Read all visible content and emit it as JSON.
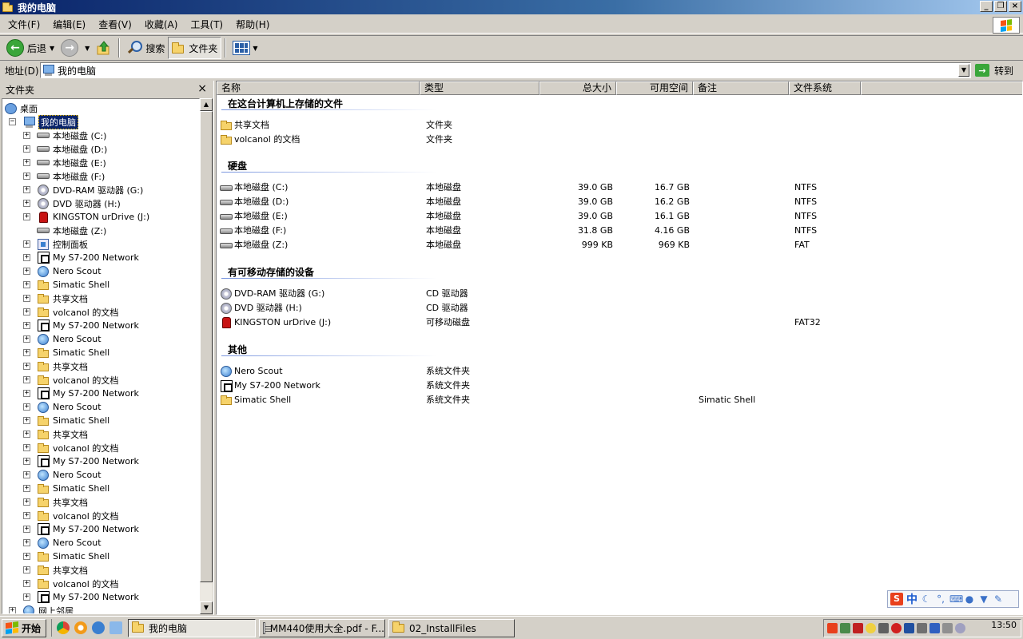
{
  "window": {
    "title": "我的电脑"
  },
  "menu": [
    "文件(F)",
    "编辑(E)",
    "查看(V)",
    "收藏(A)",
    "工具(T)",
    "帮助(H)"
  ],
  "toolbar": {
    "back": "后退",
    "search": "搜索",
    "folders": "文件夹"
  },
  "address": {
    "label": "地址(D)",
    "value": "我的电脑",
    "go": "转到"
  },
  "folders_pane": {
    "title": "文件夹"
  },
  "tree": [
    {
      "label": "桌面",
      "icon": "desktop-icon",
      "level": 0,
      "expander": ""
    },
    {
      "label": "我的电脑",
      "icon": "computer-icon",
      "level": 1,
      "expander": "−",
      "selected": true
    },
    {
      "label": "本地磁盘 (C:)",
      "icon": "drive-icon",
      "level": 2,
      "expander": "+"
    },
    {
      "label": "本地磁盘 (D:)",
      "icon": "drive-icon",
      "level": 2,
      "expander": "+"
    },
    {
      "label": "本地磁盘 (E:)",
      "icon": "drive-icon",
      "level": 2,
      "expander": "+"
    },
    {
      "label": "本地磁盘 (F:)",
      "icon": "drive-icon",
      "level": 2,
      "expander": "+"
    },
    {
      "label": "DVD-RAM 驱动器 (G:)",
      "icon": "cd-icon",
      "level": 2,
      "expander": "+"
    },
    {
      "label": "DVD 驱动器 (H:)",
      "icon": "cd-icon",
      "level": 2,
      "expander": "+"
    },
    {
      "label": "KINGSTON urDrive (J:)",
      "icon": "usb-icon",
      "level": 2,
      "expander": "+"
    },
    {
      "label": "本地磁盘 (Z:)",
      "icon": "drive-icon",
      "level": 2,
      "expander": ""
    },
    {
      "label": "控制面板",
      "icon": "control-panel-icon",
      "level": 2,
      "expander": "+"
    },
    {
      "label": "My S7-200 Network",
      "icon": "network-icon",
      "level": 2,
      "expander": "+"
    },
    {
      "label": "Nero Scout",
      "icon": "globe-icon",
      "level": 2,
      "expander": "+"
    },
    {
      "label": "Simatic Shell",
      "icon": "folder-icon",
      "level": 2,
      "expander": "+"
    },
    {
      "label": "共享文档",
      "icon": "folder-icon",
      "level": 2,
      "expander": "+"
    },
    {
      "label": "volcanol 的文档",
      "icon": "folder-icon",
      "level": 2,
      "expander": "+"
    },
    {
      "label": "My S7-200 Network",
      "icon": "network-icon",
      "level": 2,
      "expander": "+"
    },
    {
      "label": "Nero Scout",
      "icon": "globe-icon",
      "level": 2,
      "expander": "+"
    },
    {
      "label": "Simatic Shell",
      "icon": "folder-icon",
      "level": 2,
      "expander": "+"
    },
    {
      "label": "共享文档",
      "icon": "folder-icon",
      "level": 2,
      "expander": "+"
    },
    {
      "label": "volcanol 的文档",
      "icon": "folder-icon",
      "level": 2,
      "expander": "+"
    },
    {
      "label": "My S7-200 Network",
      "icon": "network-icon",
      "level": 2,
      "expander": "+"
    },
    {
      "label": "Nero Scout",
      "icon": "globe-icon",
      "level": 2,
      "expander": "+"
    },
    {
      "label": "Simatic Shell",
      "icon": "folder-icon",
      "level": 2,
      "expander": "+"
    },
    {
      "label": "共享文档",
      "icon": "folder-icon",
      "level": 2,
      "expander": "+"
    },
    {
      "label": "volcanol 的文档",
      "icon": "folder-icon",
      "level": 2,
      "expander": "+"
    },
    {
      "label": "My S7-200 Network",
      "icon": "network-icon",
      "level": 2,
      "expander": "+"
    },
    {
      "label": "Nero Scout",
      "icon": "globe-icon",
      "level": 2,
      "expander": "+"
    },
    {
      "label": "Simatic Shell",
      "icon": "folder-icon",
      "level": 2,
      "expander": "+"
    },
    {
      "label": "共享文档",
      "icon": "folder-icon",
      "level": 2,
      "expander": "+"
    },
    {
      "label": "volcanol 的文档",
      "icon": "folder-icon",
      "level": 2,
      "expander": "+"
    },
    {
      "label": "My S7-200 Network",
      "icon": "network-icon",
      "level": 2,
      "expander": "+"
    },
    {
      "label": "Nero Scout",
      "icon": "globe-icon",
      "level": 2,
      "expander": "+"
    },
    {
      "label": "Simatic Shell",
      "icon": "folder-icon",
      "level": 2,
      "expander": "+"
    },
    {
      "label": "共享文档",
      "icon": "folder-icon",
      "level": 2,
      "expander": "+"
    },
    {
      "label": "volcanol 的文档",
      "icon": "folder-icon",
      "level": 2,
      "expander": "+"
    },
    {
      "label": "My S7-200 Network",
      "icon": "network-icon",
      "level": 2,
      "expander": "+"
    },
    {
      "label": "网上邻居",
      "icon": "network-places-icon",
      "level": 1,
      "expander": "+"
    }
  ],
  "columns": [
    "名称",
    "类型",
    "总大小",
    "可用空间",
    "备注",
    "文件系统"
  ],
  "groups": [
    {
      "title": "在这台计算机上存储的文件",
      "items": [
        {
          "name": "共享文档",
          "icon": "folder-icon",
          "type": "文件夹",
          "total": "",
          "free": "",
          "note": "",
          "fs": ""
        },
        {
          "name": "volcanol 的文档",
          "icon": "folder-icon",
          "type": "文件夹",
          "total": "",
          "free": "",
          "note": "",
          "fs": ""
        }
      ]
    },
    {
      "title": "硬盘",
      "items": [
        {
          "name": "本地磁盘 (C:)",
          "icon": "drive-icon",
          "type": "本地磁盘",
          "total": "39.0 GB",
          "free": "16.7 GB",
          "note": "",
          "fs": "NTFS"
        },
        {
          "name": "本地磁盘 (D:)",
          "icon": "drive-icon",
          "type": "本地磁盘",
          "total": "39.0 GB",
          "free": "16.2 GB",
          "note": "",
          "fs": "NTFS"
        },
        {
          "name": "本地磁盘 (E:)",
          "icon": "drive-icon",
          "type": "本地磁盘",
          "total": "39.0 GB",
          "free": "16.1 GB",
          "note": "",
          "fs": "NTFS"
        },
        {
          "name": "本地磁盘 (F:)",
          "icon": "drive-icon",
          "type": "本地磁盘",
          "total": "31.8 GB",
          "free": "4.16 GB",
          "note": "",
          "fs": "NTFS"
        },
        {
          "name": "本地磁盘 (Z:)",
          "icon": "drive-icon",
          "type": "本地磁盘",
          "total": "999 KB",
          "free": "969 KB",
          "note": "",
          "fs": "FAT"
        }
      ]
    },
    {
      "title": "有可移动存储的设备",
      "items": [
        {
          "name": "DVD-RAM 驱动器 (G:)",
          "icon": "cd-icon",
          "type": "CD 驱动器",
          "total": "",
          "free": "",
          "note": "",
          "fs": ""
        },
        {
          "name": "DVD 驱动器 (H:)",
          "icon": "cd-icon",
          "type": "CD 驱动器",
          "total": "",
          "free": "",
          "note": "",
          "fs": ""
        },
        {
          "name": "KINGSTON urDrive (J:)",
          "icon": "usb-icon",
          "type": "可移动磁盘",
          "total": "",
          "free": "",
          "note": "",
          "fs": "FAT32"
        }
      ]
    },
    {
      "title": "其他",
      "items": [
        {
          "name": "Nero Scout",
          "icon": "globe-icon",
          "type": "系统文件夹",
          "total": "",
          "free": "",
          "note": "",
          "fs": ""
        },
        {
          "name": "My S7-200 Network",
          "icon": "network-icon",
          "type": "系统文件夹",
          "total": "",
          "free": "",
          "note": "",
          "fs": ""
        },
        {
          "name": "Simatic Shell",
          "icon": "folder-icon",
          "type": "系统文件夹",
          "total": "",
          "free": "",
          "note": "Simatic Shell",
          "fs": ""
        }
      ]
    }
  ],
  "ime": {
    "logo": "S",
    "mode": "中"
  },
  "taskbar": {
    "start": "开始",
    "tasks": [
      {
        "label": "我的电脑",
        "icon": "folder-icon",
        "active": true
      },
      {
        "label": "MM440使用大全.pdf - F...",
        "icon": "pdf-icon",
        "active": false
      },
      {
        "label": "02_InstallFiles",
        "icon": "folder-icon",
        "active": false
      }
    ],
    "clock": "13:50"
  }
}
